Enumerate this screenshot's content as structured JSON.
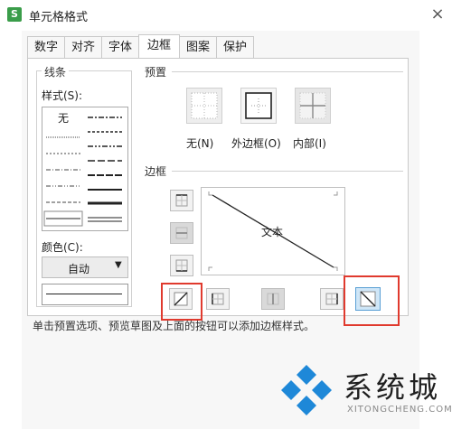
{
  "window": {
    "title": "单元格格式",
    "app_icon_glyph": "S"
  },
  "tabs": [
    {
      "label": "数字"
    },
    {
      "label": "对齐"
    },
    {
      "label": "字体"
    },
    {
      "label": "边框",
      "active": true
    },
    {
      "label": "图案"
    },
    {
      "label": "保护"
    }
  ],
  "line": {
    "group_title": "线条",
    "style_label": "样式(S):",
    "none_label": "无",
    "color_label": "颜色(C):",
    "color_value": "自动"
  },
  "preset": {
    "group_title": "预置",
    "items": [
      {
        "label": "无(N)"
      },
      {
        "label": "外边框(O)"
      },
      {
        "label": "内部(I)"
      }
    ]
  },
  "border": {
    "group_title": "边框",
    "preview_text": "文本"
  },
  "hint": "单击预置选项、预览草图及上面的按钮可以添加边框样式。",
  "watermark": {
    "brand": "系统城",
    "sub": "XITONGCHENG.COM"
  },
  "colors": {
    "highlight": "#e03a2e",
    "selected_btn": "#cfe6f7",
    "logo_blue": "#1e88d8"
  }
}
